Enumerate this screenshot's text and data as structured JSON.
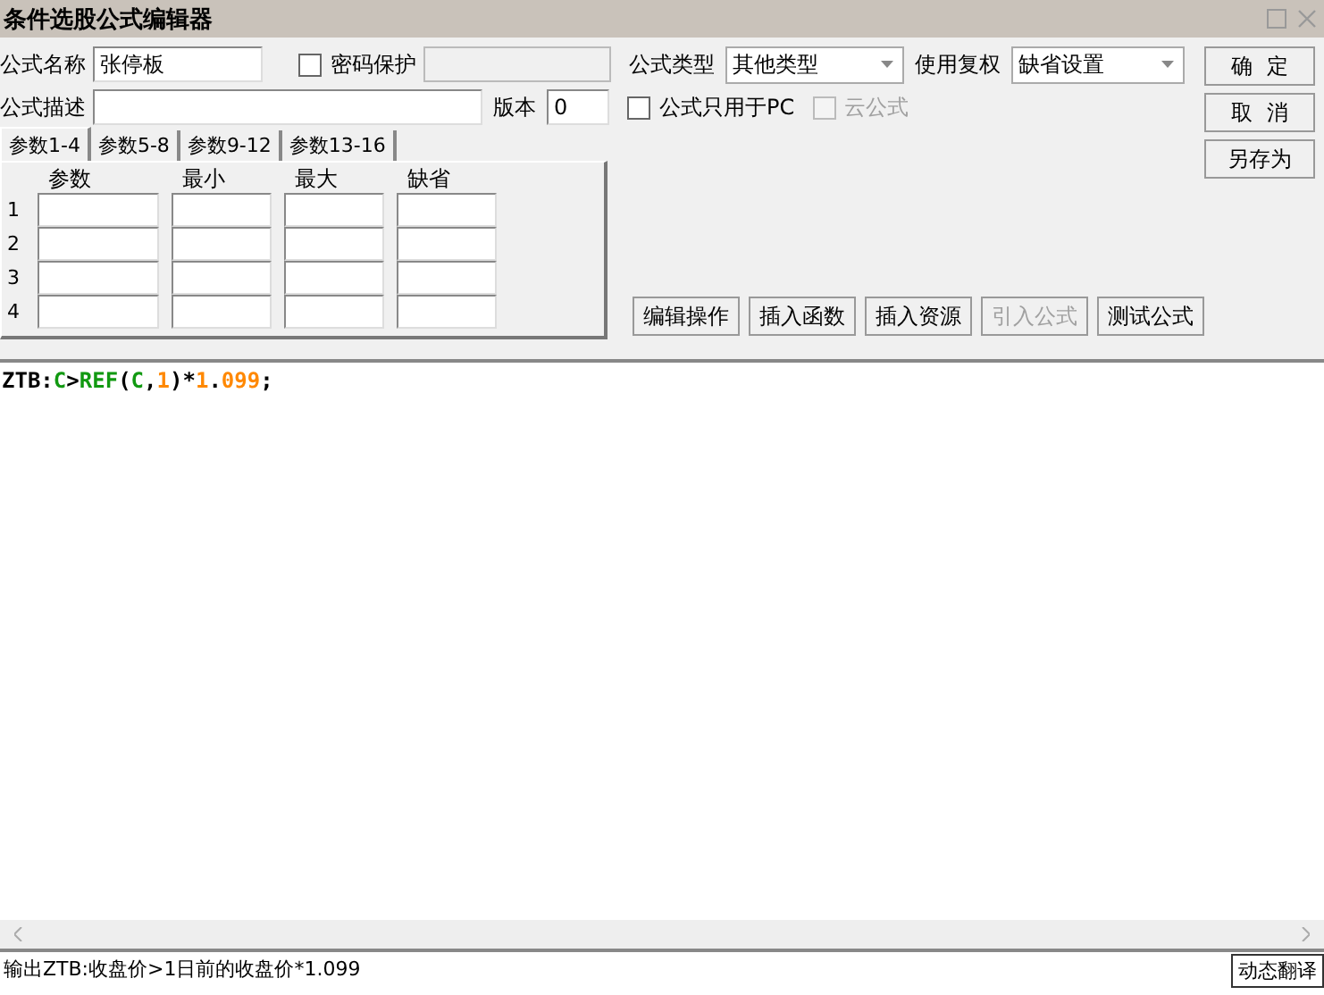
{
  "window": {
    "title": "条件选股公式编辑器"
  },
  "form": {
    "name": {
      "label": "公式名称",
      "value": "张停板"
    },
    "password": {
      "label": "密码保护",
      "checked": false
    },
    "formula_type": {
      "label": "公式类型",
      "value": "其他类型"
    },
    "adjust": {
      "label": "使用复权",
      "value": "缺省设置"
    },
    "description": {
      "label": "公式描述"
    },
    "version": {
      "label": "版本",
      "value": "0"
    },
    "pc_only": {
      "label": "公式只用于PC",
      "checked": false,
      "disabled": false
    },
    "cloud": {
      "label": "云公式",
      "checked": false,
      "disabled": true
    }
  },
  "tabs": [
    {
      "label": "参数1-4",
      "selected": true
    },
    {
      "label": "参数5-8",
      "selected": false
    },
    {
      "label": "参数9-12",
      "selected": false
    },
    {
      "label": "参数13-16",
      "selected": false
    }
  ],
  "params": {
    "columns": [
      "参数",
      "最小",
      "最大",
      "缺省"
    ],
    "rows": [
      "1",
      "2",
      "3",
      "4"
    ]
  },
  "side_buttons": [
    {
      "label": "确  定"
    },
    {
      "label": "取  消"
    },
    {
      "label": "另存为"
    }
  ],
  "actions": [
    {
      "label": "编辑操作",
      "disabled": false
    },
    {
      "label": "插入函数",
      "disabled": false
    },
    {
      "label": "插入资源",
      "disabled": false
    },
    {
      "label": "引入公式",
      "disabled": true
    },
    {
      "label": "测试公式",
      "disabled": false
    }
  ],
  "code": [
    {
      "text": "ZTB:",
      "kind": "plain"
    },
    {
      "text": "C",
      "kind": "name"
    },
    {
      "text": ">",
      "kind": "plain"
    },
    {
      "text": "REF",
      "kind": "name"
    },
    {
      "text": "(",
      "kind": "plain"
    },
    {
      "text": "C",
      "kind": "name"
    },
    {
      "text": ",",
      "kind": "plain"
    },
    {
      "text": "1",
      "kind": "number"
    },
    {
      "text": ")*",
      "kind": "plain"
    },
    {
      "text": "1",
      "kind": "number"
    },
    {
      "text": ".",
      "kind": "plain"
    },
    {
      "text": "099",
      "kind": "number"
    },
    {
      "text": ";",
      "kind": "plain"
    }
  ],
  "status": {
    "text": "输出ZTB:收盘价>1日前的收盘价*1.099",
    "button": "动态翻译"
  }
}
